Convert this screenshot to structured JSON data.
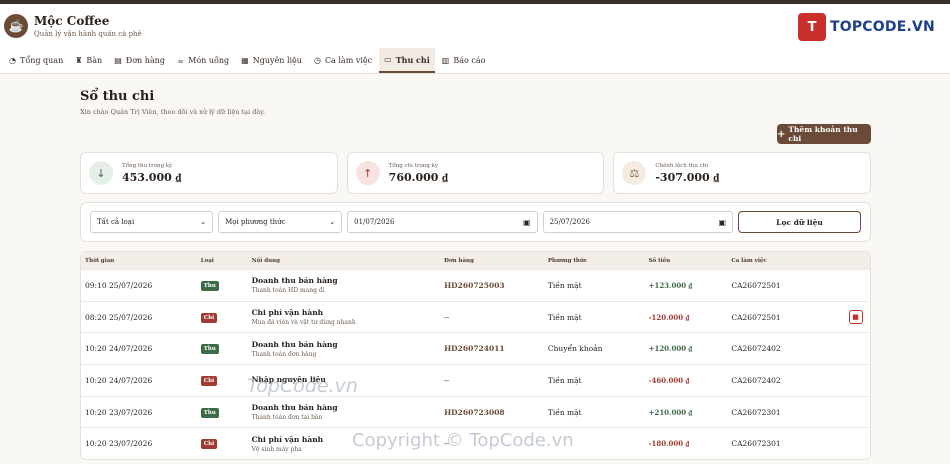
{
  "app": {
    "title": "Mộc Coffee",
    "subtitle": "Quản lý vận hành quán cà phê",
    "logo_icon": "☕"
  },
  "topcode_logo": {
    "mark": "T",
    "text": "TOPCODE.VN"
  },
  "nav": [
    {
      "label": "Tổng quan",
      "icon": "◔",
      "icon_name": "pie-chart-icon"
    },
    {
      "label": "Bàn",
      "icon": "♜",
      "icon_name": "chair-icon"
    },
    {
      "label": "Đơn hàng",
      "icon": "▤",
      "icon_name": "receipt-icon"
    },
    {
      "label": "Món uống",
      "icon": "☕",
      "icon_name": "cup-icon"
    },
    {
      "label": "Nguyên liệu",
      "icon": "▦",
      "icon_name": "boxes-icon"
    },
    {
      "label": "Ca làm việc",
      "icon": "◷",
      "icon_name": "clock-icon"
    },
    {
      "label": "Thu chi",
      "icon": "▭",
      "icon_name": "wallet-icon",
      "active": true
    },
    {
      "label": "Báo cáo",
      "icon": "▥",
      "icon_name": "chart-icon"
    }
  ],
  "page": {
    "title": "Sổ thu chi",
    "subtitle": "Xin chào Quản Trị Viên, theo dõi và xử lý dữ liệu tại đây.",
    "add_button": "Thêm khoản thu chi"
  },
  "stats": [
    {
      "label": "Tổng thu trong kỳ",
      "value": "453.000 ₫",
      "icon": "↓",
      "kind": "in"
    },
    {
      "label": "Tổng chi trong kỳ",
      "value": "760.000 ₫",
      "icon": "↑",
      "kind": "out"
    },
    {
      "label": "Chênh lệch thu chi",
      "value": "-307.000 ₫",
      "icon": "⚖",
      "kind": "bal"
    }
  ],
  "filters": {
    "type": "Tất cả loại",
    "method": "Mọi phương thức",
    "from": "01/07/2026",
    "to": "25/07/2026",
    "button": "Lọc dữ liệu"
  },
  "table": {
    "headers": [
      "Thời gian",
      "Loại",
      "Nội dung",
      "Đơn hàng",
      "Phương thức",
      "Số tiền",
      "Ca làm việc"
    ],
    "rows": [
      {
        "time": "09:10 25/07/2026",
        "type": "Thu",
        "title": "Doanh thu bán hàng",
        "note": "Thanh toán HD mang đi",
        "order": "HD260725003",
        "method": "Tiền mặt",
        "amount": "+123.000 ₫",
        "shift": "CA26072501"
      },
      {
        "time": "08:20 25/07/2026",
        "type": "Chi",
        "title": "Chi phí vận hành",
        "note": "Mua đá viên và vật tư dùng nhanh",
        "order": "--",
        "method": "Tiền mặt",
        "amount": "-120.000 ₫",
        "shift": "CA26072501",
        "deletable": true
      },
      {
        "time": "10:20 24/07/2026",
        "type": "Thu",
        "title": "Doanh thu bán hàng",
        "note": "Thanh toán đơn hàng",
        "order": "HD260724011",
        "method": "Chuyển khoản",
        "amount": "+120.000 ₫",
        "shift": "CA26072402"
      },
      {
        "time": "10:20 24/07/2026",
        "type": "Chi",
        "title": "Nhập nguyên liệu",
        "note": "",
        "order": "--",
        "method": "Tiền mặt",
        "amount": "-460.000 ₫",
        "shift": "CA26072402"
      },
      {
        "time": "10:20 23/07/2026",
        "type": "Thu",
        "title": "Doanh thu bán hàng",
        "note": "Thanh toán đơn tại bàn",
        "order": "HD260723008",
        "method": "Tiền mặt",
        "amount": "+210.000 ₫",
        "shift": "CA26072301"
      },
      {
        "time": "10:20 23/07/2026",
        "type": "Chi",
        "title": "Chi phí vận hành",
        "note": "Vệ sinh máy pha",
        "order": "--",
        "method": "",
        "amount": "-180.000 ₫",
        "shift": "CA26072301"
      }
    ]
  },
  "watermarks": [
    "TopCode.vn",
    "Copyright © TopCode.vn"
  ],
  "colors": {
    "brand": "#6b4a37",
    "income": "#3e6b47",
    "expense": "#a13a30"
  }
}
